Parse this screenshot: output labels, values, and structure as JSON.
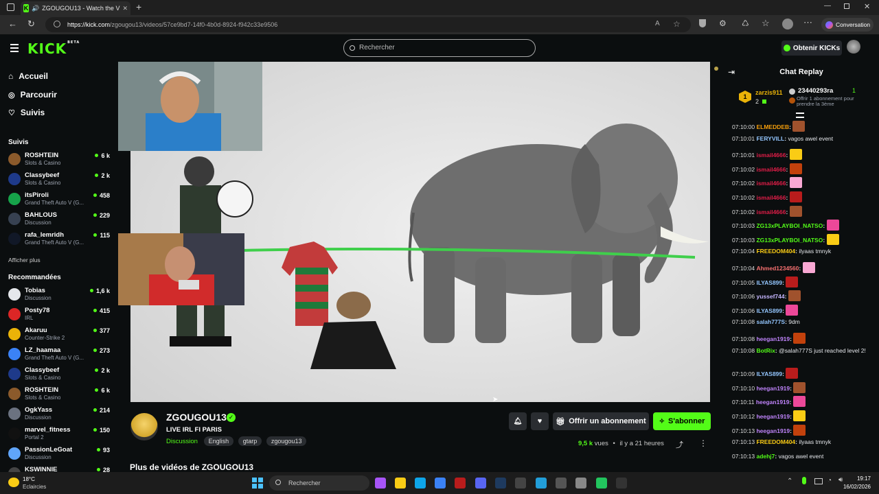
{
  "browser": {
    "tab_title": "ZGOUGOU13 - Watch the V",
    "url_domain": "https://kick.com",
    "url_path": "/zgougou13/videos/57ce9bd7-14f0-4b0d-8924-f942c33e9506",
    "conversation_label": "Conversation"
  },
  "header": {
    "logo": "KICK",
    "logo_badge": "BETA",
    "search_placeholder": "Rechercher",
    "kicks_button": "Obtenir KICKs"
  },
  "sidebar": {
    "nav": [
      {
        "label": "Accueil",
        "icon": "home-icon"
      },
      {
        "label": "Parcourir",
        "icon": "compass-icon"
      },
      {
        "label": "Suivis",
        "icon": "heart-icon"
      }
    ],
    "followed_title": "Suivis",
    "followed": [
      {
        "name": "ROSHTEIN",
        "category": "Slots & Casino",
        "viewers": "6 k",
        "color": "#8b5a2b"
      },
      {
        "name": "Classybeef",
        "category": "Slots & Casino",
        "viewers": "2 k",
        "color": "#1e3a8a"
      },
      {
        "name": "itsPiroli",
        "category": "Grand Theft Auto V (G...",
        "viewers": "458",
        "color": "#16a34a"
      },
      {
        "name": "BAHLOUS",
        "category": "Discussion",
        "viewers": "229",
        "color": "#374151"
      },
      {
        "name": "rafa_lemridh",
        "category": "Grand Theft Auto V (G...",
        "viewers": "115",
        "color": "#111827"
      }
    ],
    "show_more": "Afficher plus",
    "recommended_title": "Recommandées",
    "recommended": [
      {
        "name": "Tobias",
        "category": "Discussion",
        "viewers": "1,6 k",
        "color": "#e5e7eb"
      },
      {
        "name": "Posty78",
        "category": "IRL",
        "viewers": "415",
        "color": "#dc2626"
      },
      {
        "name": "Akaruu",
        "category": "Counter-Strike 2",
        "viewers": "377",
        "color": "#eab308"
      },
      {
        "name": "LZ_haamaa",
        "category": "Grand Theft Auto V (G...",
        "viewers": "273",
        "color": "#3b82f6"
      },
      {
        "name": "Classybeef",
        "category": "Slots & Casino",
        "viewers": "2 k",
        "color": "#1e3a8a"
      },
      {
        "name": "ROSHTEIN",
        "category": "Slots & Casino",
        "viewers": "6 k",
        "color": "#8b5a2b"
      },
      {
        "name": "OgkYass",
        "category": "Discussion",
        "viewers": "214",
        "color": "#6b7280"
      },
      {
        "name": "marvel_fitness",
        "category": "Portal 2",
        "viewers": "150",
        "color": "#111"
      },
      {
        "name": "PassionLeGoat",
        "category": "Discussion",
        "viewers": "93",
        "color": "#60a5fa"
      },
      {
        "name": "KSWINNIE",
        "category": "",
        "viewers": "28",
        "color": "#444"
      }
    ]
  },
  "streamer": {
    "name": "ZGOUGOU13",
    "title": "LIVE IRL FI PARIS",
    "category": "Discussion",
    "tags": [
      "English",
      "gtarp",
      "zgougou13"
    ],
    "gift_button": "Offrir un abonnement",
    "subscribe_button": "S'abonner",
    "views_count": "9,5 k",
    "views_label": "vues",
    "time_ago": "il y a 21 heures",
    "more_videos": "Plus de vidéos de ZGOUGOU13"
  },
  "chat": {
    "title": "Chat Replay",
    "gifter_rank": "1",
    "gifter_name": "zarzis911",
    "gifter_count": "2",
    "gift_user": "23440293ra",
    "gift_count": "1",
    "gift_text": "Offrir 1 abonnement pour prendre la 3ème",
    "messages": [
      {
        "time": "07:10:00",
        "user": "ELMEDDEB",
        "color": "#f59e0b",
        "text": ""
      },
      {
        "time": "07:10:01",
        "user": "FERYVILL",
        "color": "#93c5fd",
        "text": "vagos awel event"
      },
      {
        "time": "07:10:01",
        "user": "ismail4666",
        "color": "#e11d48",
        "text": ""
      },
      {
        "time": "07:10:02",
        "user": "ismail4666",
        "color": "#e11d48",
        "text": ""
      },
      {
        "time": "07:10:02",
        "user": "ismail4666",
        "color": "#e11d48",
        "text": ""
      },
      {
        "time": "07:10:02",
        "user": "ismail4666",
        "color": "#e11d48",
        "text": ""
      },
      {
        "time": "07:10:02",
        "user": "ismail4666",
        "color": "#e11d48",
        "text": ""
      },
      {
        "time": "07:10:03",
        "user": "ZG13xPLAYBOI_NATSO",
        "color": "#53fc18",
        "text": ""
      },
      {
        "time": "07:10:03",
        "user": "ZG13xPLAYBOI_NATSO",
        "color": "#53fc18",
        "text": ""
      },
      {
        "time": "07:10:04",
        "user": "FREEDOM404",
        "color": "#facc15",
        "text": "ilyaas tmnyk"
      },
      {
        "time": "07:10:04",
        "user": "Ahmed1234560",
        "color": "#f87171",
        "text": ""
      },
      {
        "time": "07:10:05",
        "user": "ILYAS899",
        "color": "#93c5fd",
        "text": ""
      },
      {
        "time": "07:10:06",
        "user": "yussef744",
        "color": "#c4b5fd",
        "text": ""
      },
      {
        "time": "07:10:06",
        "user": "ILYAS899",
        "color": "#93c5fd",
        "text": ""
      },
      {
        "time": "07:10:08",
        "user": "salah777S",
        "color": "#93c5fd",
        "text": "9dm"
      },
      {
        "time": "07:10:08",
        "user": "heegan1919",
        "color": "#c084fc",
        "text": ""
      },
      {
        "time": "07:10:08",
        "user": "BotRix",
        "color": "#53fc18",
        "text": "@salah777S just reached level 2!"
      },
      {
        "time": "07:10:09",
        "user": "ILYAS899",
        "color": "#93c5fd",
        "text": ""
      },
      {
        "time": "07:10:10",
        "user": "heegan1919",
        "color": "#c084fc",
        "text": ""
      },
      {
        "time": "07:10:11",
        "user": "heegan1919",
        "color": "#c084fc",
        "text": ""
      },
      {
        "time": "07:10:12",
        "user": "heegan1919",
        "color": "#c084fc",
        "text": ""
      },
      {
        "time": "07:10:13",
        "user": "heegan1919",
        "color": "#c084fc",
        "text": ""
      },
      {
        "time": "07:10:13",
        "user": "FREEDOM404",
        "color": "#facc15",
        "text": "ilyaas tmnyk"
      },
      {
        "time": "07:10:13",
        "user": "adehj7",
        "color": "#53fc18",
        "text": "vagos awel event"
      }
    ]
  },
  "taskbar": {
    "weather_temp": "18°C",
    "weather_text": "Eclaircies",
    "search_placeholder": "Rechercher",
    "time": "19:17",
    "date": "16/02/2026"
  }
}
